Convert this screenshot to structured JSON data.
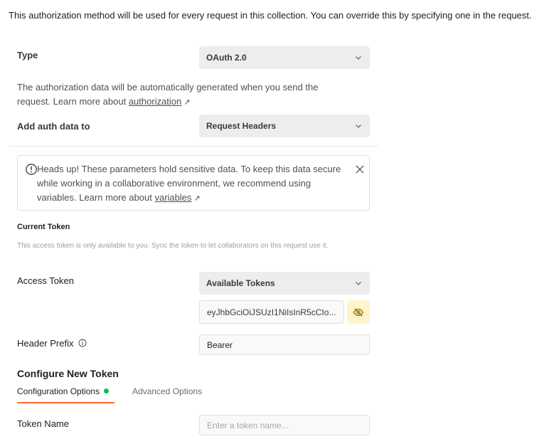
{
  "intro_text": "This authorization method will be used for every request in this collection. You can override this by specifying one in the request.",
  "type_row": {
    "label": "Type",
    "value": "OAuth 2.0"
  },
  "description": {
    "text": "The authorization data will be automatically generated when you send the request. Learn more about ",
    "link": "authorization",
    "arrow": "↗"
  },
  "auth_data_row": {
    "label": "Add auth data to",
    "value": "Request Headers"
  },
  "alert": {
    "text": "Heads up! These parameters hold sensitive data. To keep this data secure while working in a collaborative environment, we recommend using variables. Learn more about ",
    "link": "variables",
    "arrow": "↗"
  },
  "current_token": {
    "title": "Current Token",
    "hint": "This access token is only available to you. Sync the token to let collaborators on this request use it.",
    "access_token_label": "Access Token",
    "available_tokens": "Available Tokens",
    "token_value": "eyJhbGciOiJSUzI1NiIsInR5cCIo..."
  },
  "header_prefix": {
    "label": "Header Prefix",
    "value": "Bearer"
  },
  "configure": {
    "title": "Configure New Token",
    "tabs": [
      {
        "label": "Configuration Options"
      },
      {
        "label": "Advanced Options"
      }
    ]
  },
  "token_name": {
    "label": "Token Name",
    "placeholder": "Enter a token name..."
  },
  "colors": {
    "accent": "#ff6c37",
    "status_dot": "#0cbb52",
    "eye_bg": "#fff4cc"
  }
}
